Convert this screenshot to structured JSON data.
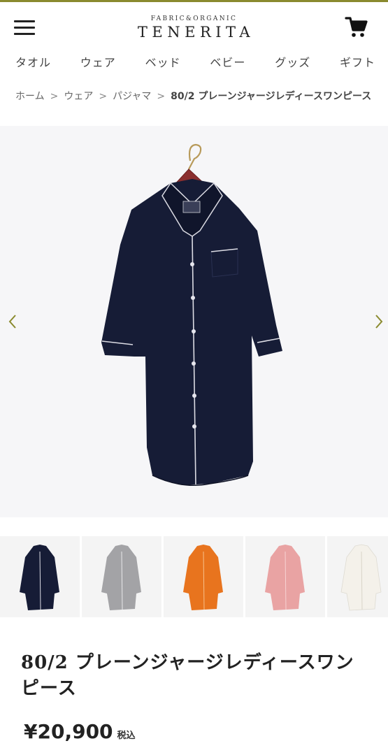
{
  "header": {
    "logo_sub": "FABRIC&ORGANIC",
    "logo_main": "TENERITA"
  },
  "nav": {
    "categories": [
      "タオル",
      "ウェア",
      "ベッド",
      "ベビー",
      "グッズ",
      "ギフト"
    ]
  },
  "breadcrumb": {
    "items": [
      "ホーム",
      "ウェア",
      "パジャマ"
    ],
    "separator": ">",
    "current": "80/2 プレーンジャージレディースワンピース"
  },
  "gallery": {
    "main_color": "#161c36",
    "thumbnail_colors": [
      "#161c36",
      "#a3a3a6",
      "#e8741e",
      "#e9a3a3",
      "#f4f1ea"
    ]
  },
  "product": {
    "title": "80/2 プレーンジャージレディースワンピース",
    "price": "¥20,900",
    "tax_label": "税込"
  },
  "colors": {
    "accent_line": "#8a8a2e",
    "arrow": "#8a8a2e"
  }
}
